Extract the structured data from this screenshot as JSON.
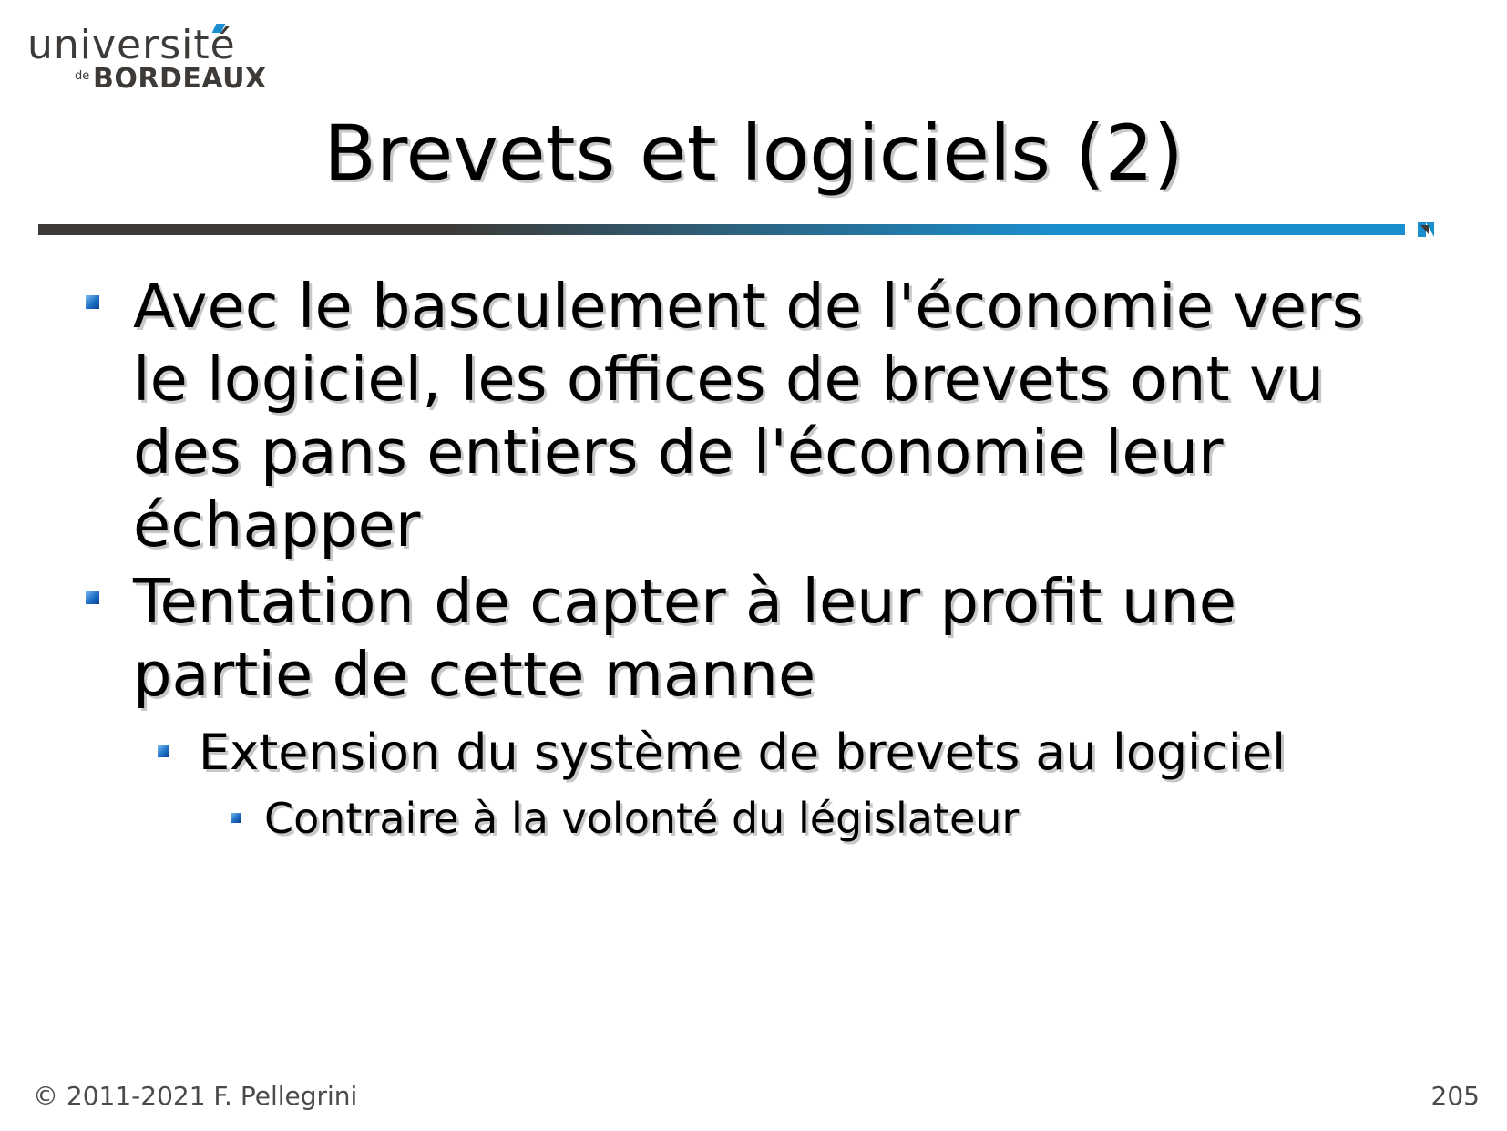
{
  "logo": {
    "line1": "université",
    "de": "de",
    "line2": "BORDEAUX"
  },
  "slide": {
    "title": "Brevets et logiciels (2)",
    "bullets": [
      {
        "level": 1,
        "text": "Avec le basculement de l'économie vers le logiciel, les offices de brevets ont vu des pans entiers de l'économie leur échapper"
      },
      {
        "level": 1,
        "text": "Tentation de capter à leur profit une partie de cette manne"
      },
      {
        "level": 2,
        "text": "Extension du système de brevets au logiciel"
      },
      {
        "level": 3,
        "text": "Contraire à la volonté du législateur"
      }
    ]
  },
  "footer": {
    "copyright": "© 2011-2021 F. Pellegrini",
    "page_number": "205"
  },
  "colors": {
    "accent_blue": "#1a8fcf",
    "dark_gray": "#3d3a37"
  }
}
